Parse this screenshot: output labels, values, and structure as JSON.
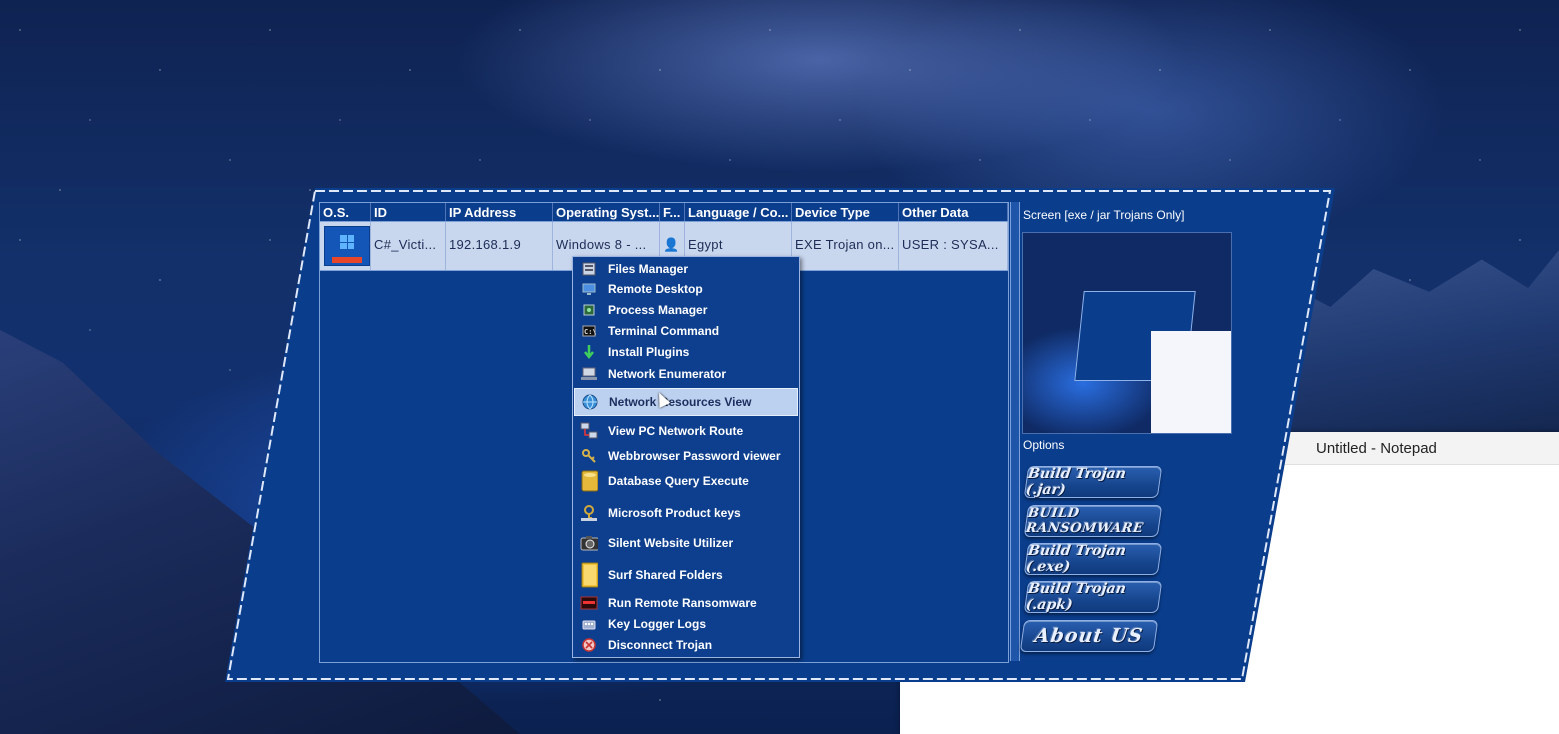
{
  "table": {
    "columns": [
      "O.S.",
      "ID",
      "IP Address",
      "Operating Syst...",
      "F...",
      "Language / Co...",
      "Device Type",
      "Other Data"
    ],
    "rows": [
      {
        "os_icon": "windows-icon",
        "id": "C#_Victi...",
        "ip": "192.168.1.9",
        "os": "Windows 8 - ...",
        "flag_icon": "user-icon",
        "language": "Egypt",
        "device_type": "EXE Trojan on...",
        "other": "USER : SYSA..."
      }
    ]
  },
  "context_menu": {
    "items": [
      {
        "label": "Files Manager",
        "icon": "files-icon"
      },
      {
        "label": "Remote Desktop",
        "icon": "monitor-icon"
      },
      {
        "label": "Process Manager",
        "icon": "process-icon"
      },
      {
        "label": "Terminal Command",
        "icon": "terminal-icon"
      },
      {
        "label": "Install Plugins",
        "icon": "download-arrow-icon"
      },
      {
        "label": "Network Enumerator",
        "icon": "network-icon"
      },
      {
        "label": "Network Resources View",
        "icon": "globe-icon",
        "highlighted": true
      },
      {
        "label": "View PC Network Route",
        "icon": "route-icon"
      },
      {
        "label": "Webbrowser Password viewer",
        "icon": "key-tools-icon"
      },
      {
        "label": "Database Query Execute",
        "icon": "database-icon"
      },
      {
        "label": "Microsoft Product keys",
        "icon": "product-key-icon"
      },
      {
        "label": "Silent Website Utilizer",
        "icon": "camera-icon"
      },
      {
        "label": "Surf Shared Folders",
        "icon": "folder-icon"
      },
      {
        "label": "Run Remote Ransomware",
        "icon": "ransomware-icon"
      },
      {
        "label": "Key Logger Logs",
        "icon": "keyboard-icon"
      },
      {
        "label": "Disconnect Trojan",
        "icon": "disconnect-icon"
      }
    ]
  },
  "right_panel": {
    "screen_label": "Screen  [exe / jar Trojans Only]",
    "options_label": "Options",
    "buttons": [
      {
        "label": "Build Trojan (.jar)"
      },
      {
        "label": "BUILD RANSOMWARE"
      },
      {
        "label": "Build Trojan (.exe)"
      },
      {
        "label": "Build Trojan (.apk)"
      },
      {
        "label": "About US"
      }
    ]
  },
  "notepad": {
    "title": "Untitled - Notepad"
  },
  "colors": {
    "window_bg": "#0a3d8c",
    "row_bg": "#c8d6ee",
    "menu_bg": "#0e3f8e",
    "menu_highlight": "#bcd0ef"
  }
}
